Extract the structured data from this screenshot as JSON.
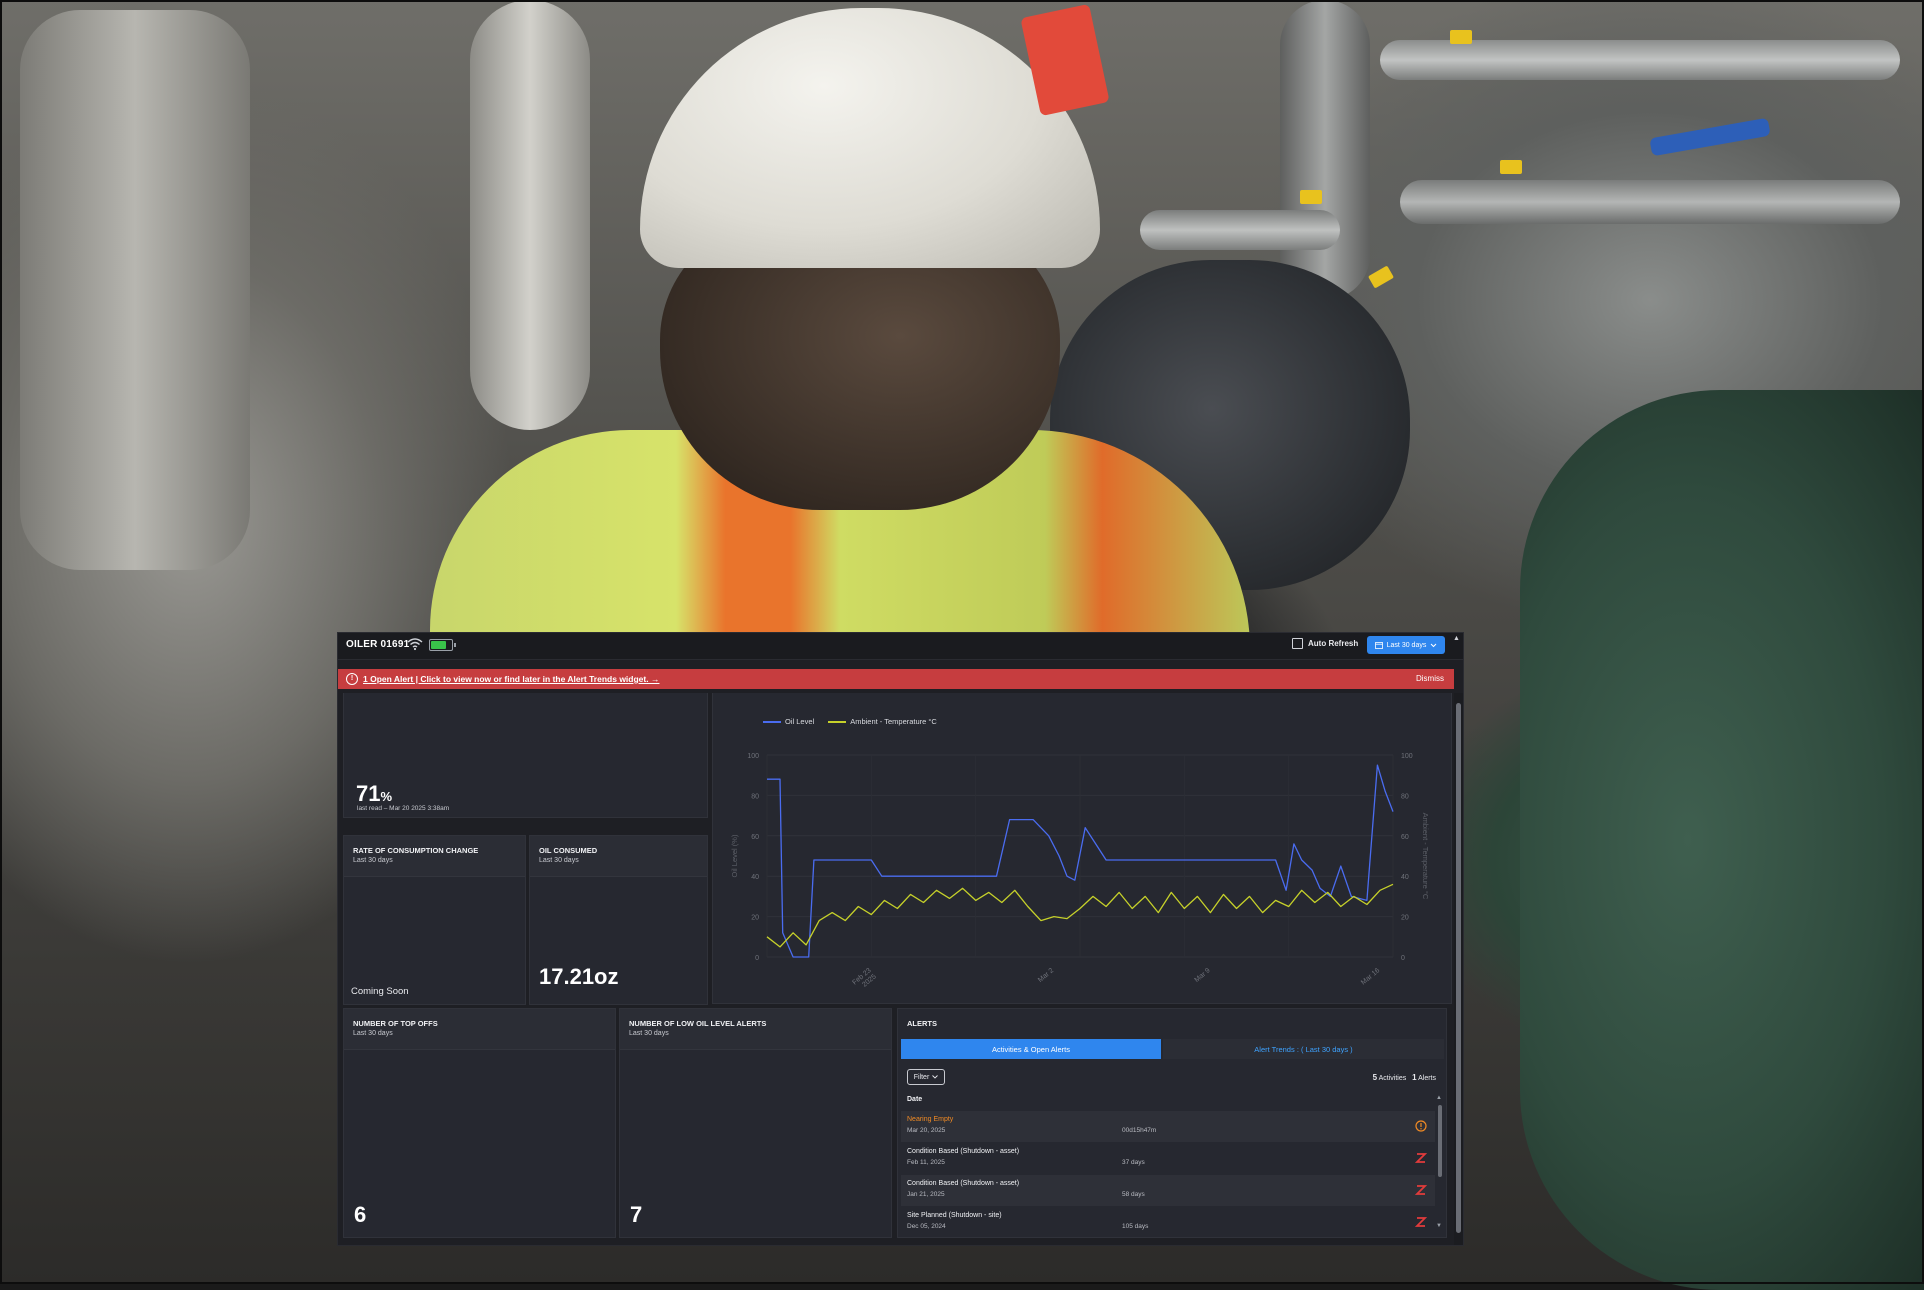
{
  "device": {
    "name": "OILER 01691",
    "battery_level": 0.75
  },
  "topbar": {
    "auto_refresh_label": "Auto Refresh",
    "auto_refresh_checked": false,
    "range_label": "Last 30 days"
  },
  "alert_banner": {
    "text": "1 Open Alert | Click to view now or find later in the Alert Trends widget. →",
    "dismiss_label": "Dismiss"
  },
  "oil_level_card": {
    "value": "71",
    "unit": "%",
    "last_read": "last read – Mar 20 2025 3:38am"
  },
  "rate_card": {
    "title": "RATE OF CONSUMPTION CHANGE",
    "subtitle": "Last 30 days",
    "value": "Coming Soon"
  },
  "oil_consumed_card": {
    "title": "OIL CONSUMED",
    "subtitle": "Last 30 days",
    "value": "17.21oz"
  },
  "top_offs_card": {
    "title": "NUMBER OF TOP OFFS",
    "subtitle": "Last 30 days",
    "value": "6"
  },
  "low_oil_card": {
    "title": "NUMBER OF LOW OIL LEVEL ALERTS",
    "subtitle": "Last 30 days",
    "value": "7"
  },
  "alerts_card": {
    "title": "ALERTS",
    "tabs": [
      "Activities & Open Alerts",
      "Alert Trends : ( Last 30 days )"
    ],
    "filter_label": "Filter",
    "activities_count": "5",
    "activities_label": "Activities",
    "alerts_count": "1",
    "alerts_label": "Alerts",
    "column_date": "Date",
    "rows": [
      {
        "title": "Nearing Empty",
        "date": "Mar 20, 2025",
        "duration": "00d15h47m",
        "status": "warning",
        "title_color": "#f08a24"
      },
      {
        "title": "Condition Based (Shutdown - asset)",
        "date": "Feb 11, 2025",
        "duration": "37 days",
        "status": "shutdown",
        "title_color": "#f1f2f5"
      },
      {
        "title": "Condition Based (Shutdown - asset)",
        "date": "Jan 21, 2025",
        "duration": "58 days",
        "status": "shutdown",
        "title_color": "#f1f2f5"
      },
      {
        "title": "Site Planned (Shutdown - site)",
        "date": "Dec 05, 2024",
        "duration": "105 days",
        "status": "shutdown",
        "title_color": "#f1f2f5"
      }
    ]
  },
  "colors": {
    "accent": "#2f86ee",
    "alert_red": "#c63d3f",
    "oil_series": "#4a6cf0",
    "temp_series": "#c6d12a",
    "warning": "#f08a24",
    "shutdown": "#e23b3b"
  },
  "chart_data": {
    "type": "line",
    "x_ticks": [
      "Feb 23\n2025",
      "Mar 2",
      "Mar 9",
      "Mar 16"
    ],
    "y_left": {
      "label": "Oil Level (%)",
      "ticks": [
        0,
        20,
        40,
        60,
        80,
        100
      ],
      "lim": [
        0,
        100
      ]
    },
    "y_right": {
      "label": "Ambient - Temperature °C",
      "ticks": [
        0,
        20,
        40,
        60,
        80,
        100
      ],
      "lim": [
        0,
        100
      ]
    },
    "grid": true,
    "legend_position": "top-left",
    "series": [
      {
        "name": "Oil Level",
        "color": "#4a6cf0",
        "points": [
          [
            0,
            88
          ],
          [
            0.5,
            88
          ],
          [
            0.6,
            12
          ],
          [
            1.0,
            0
          ],
          [
            1.6,
            0
          ],
          [
            1.8,
            48
          ],
          [
            4.0,
            48
          ],
          [
            4.4,
            40
          ],
          [
            8.8,
            40
          ],
          [
            9.3,
            68
          ],
          [
            10.2,
            68
          ],
          [
            10.8,
            60
          ],
          [
            11.2,
            50
          ],
          [
            11.5,
            40
          ],
          [
            11.8,
            38
          ],
          [
            12.2,
            64
          ],
          [
            12.6,
            56
          ],
          [
            13.0,
            48
          ],
          [
            19.5,
            48
          ],
          [
            19.9,
            33
          ],
          [
            20.2,
            56
          ],
          [
            20.5,
            48
          ],
          [
            20.9,
            43
          ],
          [
            21.2,
            34
          ],
          [
            21.6,
            30
          ],
          [
            22.0,
            45
          ],
          [
            22.4,
            30
          ],
          [
            23.0,
            28
          ],
          [
            23.4,
            95
          ],
          [
            23.7,
            82
          ],
          [
            24.0,
            72
          ]
        ]
      },
      {
        "name": "Ambient - Temperature °C",
        "color": "#c6d12a",
        "points": [
          [
            0,
            10
          ],
          [
            0.5,
            5
          ],
          [
            1.0,
            12
          ],
          [
            1.5,
            6
          ],
          [
            2.0,
            18
          ],
          [
            2.5,
            22
          ],
          [
            3.0,
            18
          ],
          [
            3.5,
            25
          ],
          [
            4.0,
            21
          ],
          [
            4.5,
            28
          ],
          [
            5.0,
            24
          ],
          [
            5.5,
            31
          ],
          [
            6.0,
            27
          ],
          [
            6.5,
            33
          ],
          [
            7.0,
            29
          ],
          [
            7.5,
            34
          ],
          [
            8.0,
            28
          ],
          [
            8.5,
            32
          ],
          [
            9.0,
            27
          ],
          [
            9.5,
            33
          ],
          [
            10.0,
            25
          ],
          [
            10.5,
            18
          ],
          [
            11.0,
            20
          ],
          [
            11.5,
            19
          ],
          [
            12.0,
            24
          ],
          [
            12.5,
            30
          ],
          [
            13.0,
            25
          ],
          [
            13.5,
            32
          ],
          [
            14.0,
            24
          ],
          [
            14.5,
            30
          ],
          [
            15.0,
            22
          ],
          [
            15.5,
            32
          ],
          [
            16.0,
            24
          ],
          [
            16.5,
            30
          ],
          [
            17.0,
            22
          ],
          [
            17.5,
            31
          ],
          [
            18.0,
            24
          ],
          [
            18.5,
            30
          ],
          [
            19.0,
            22
          ],
          [
            19.5,
            28
          ],
          [
            20.0,
            25
          ],
          [
            20.5,
            33
          ],
          [
            21.0,
            27
          ],
          [
            21.5,
            32
          ],
          [
            22.0,
            25
          ],
          [
            22.5,
            30
          ],
          [
            23.0,
            26
          ],
          [
            23.5,
            33
          ],
          [
            24.0,
            36
          ]
        ]
      }
    ]
  }
}
